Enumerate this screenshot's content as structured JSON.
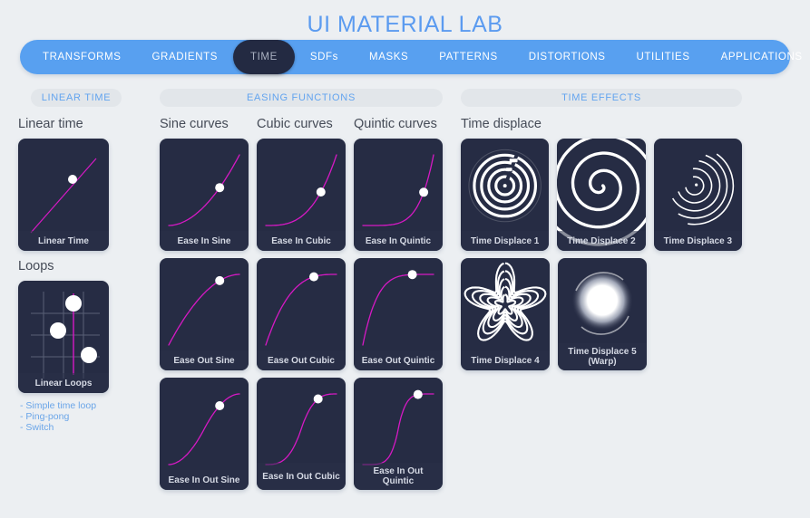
{
  "header": {
    "title": "UI MATERIAL LAB"
  },
  "nav": {
    "tabs": [
      {
        "label": "TRANSFORMS",
        "active": false
      },
      {
        "label": "GRADIENTS",
        "active": false
      },
      {
        "label": "TIME",
        "active": true
      },
      {
        "label": "SDFs",
        "active": false
      },
      {
        "label": "MASKS",
        "active": false
      },
      {
        "label": "PATTERNS",
        "active": false
      },
      {
        "label": "DISTORTIONS",
        "active": false
      },
      {
        "label": "UTILITIES",
        "active": false
      },
      {
        "label": "APPLICATIONS",
        "active": false
      }
    ]
  },
  "sections": {
    "linear": {
      "pill": "LINEAR TIME",
      "groups": [
        {
          "title": "Linear time",
          "cards": [
            {
              "label": "Linear Time"
            }
          ]
        },
        {
          "title": "Loops",
          "cards": [
            {
              "label": "Linear Loops"
            }
          ]
        }
      ],
      "links": [
        "- Simple time loop",
        "- Ping-pong",
        "- Switch"
      ]
    },
    "easing": {
      "pill": "EASING FUNCTIONS",
      "column_titles": [
        "Sine curves",
        "Cubic curves",
        "Quintic curves"
      ],
      "rows": [
        [
          {
            "label": "Ease In Sine"
          },
          {
            "label": "Ease In Cubic"
          },
          {
            "label": "Ease In Quintic"
          }
        ],
        [
          {
            "label": "Ease Out Sine"
          },
          {
            "label": "Ease Out Cubic"
          },
          {
            "label": "Ease Out Quintic"
          }
        ],
        [
          {
            "label": "Ease In Out Sine"
          },
          {
            "label": "Ease In Out Cubic"
          },
          {
            "label": "Ease In Out Quintic"
          }
        ]
      ]
    },
    "effects": {
      "pill": "TIME EFFECTS",
      "group_title": "Time displace",
      "rows": [
        [
          {
            "label": "Time Displace 1"
          },
          {
            "label": "Time Displace 2"
          },
          {
            "label": "Time Displace 3"
          }
        ],
        [
          {
            "label": "Time Displace 4"
          },
          {
            "label": "Time Displace 5 (Warp)"
          }
        ]
      ]
    }
  },
  "colors": {
    "accent_blue": "#58a0f0",
    "title_blue": "#5b9bf0",
    "card_dark": "#262c44",
    "curve_magenta": "#d619c4",
    "page_bg": "#eceff2",
    "active_tab": "#232a42"
  }
}
